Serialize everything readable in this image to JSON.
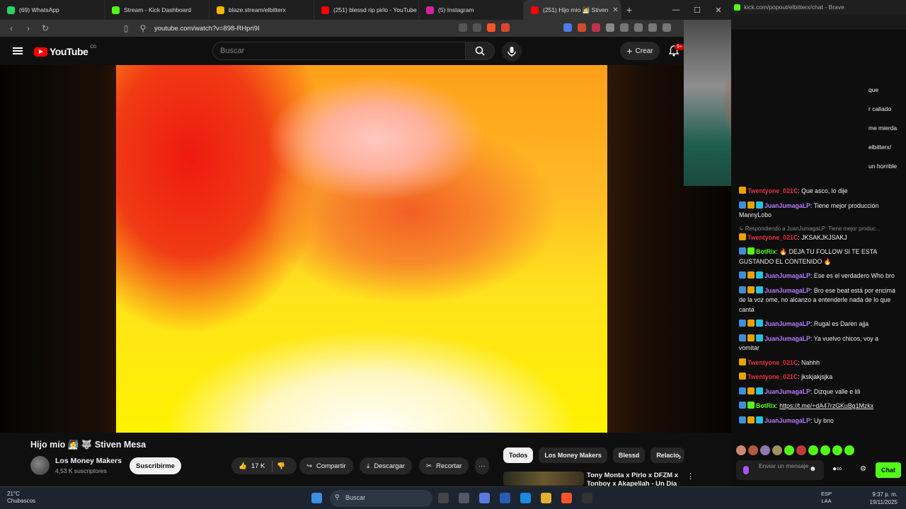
{
  "browser_tabs": [
    {
      "label": "(69) WhatsApp",
      "color": "#25d366"
    },
    {
      "label": "Stream - Kick Dashboard",
      "color": "#53fc18"
    },
    {
      "label": "blaze.stream/elbitterx",
      "color": "#f5b800"
    },
    {
      "label": "(251) blessd rip pirlo - YouTube",
      "color": "#ff0000"
    },
    {
      "label": "(5) Instagram",
      "color": "#d6249f"
    },
    {
      "label": "(251) Hijo mío 🧖 Stiven",
      "color": "#ff0000"
    }
  ],
  "url": "youtube.com/watch?v=898-RHpri9I",
  "youtube": {
    "logo": "YouTube",
    "country": "CO",
    "search_placeholder": "Buscar",
    "create_label": "Crear",
    "notif_badge": "9+",
    "video_title": "Hijo mío 🧖 🐺 Stiven Mesa",
    "channel_name": "Los Money Makers",
    "subscribers": "4,53 K suscriptores",
    "subscribe_label": "Suscribirme",
    "likes": "17 K",
    "share_label": "Compartir",
    "download_label": "Descargar",
    "clip_label": "Recortar",
    "more_label": "···",
    "chips": [
      "Todos",
      "Los Money Makers",
      "Blessd",
      "Relacio"
    ],
    "rec_title": "Tony Monta x Pirlo x DFZM x Tonboy x Akapellah - Un Día F"
  },
  "kick_popup": {
    "url": "kick.com/popout/elbitterx/chat - Brave",
    "side_fragments": [
      "que",
      "r callado",
      "me mierda",
      "elbitterx/",
      "un horrible"
    ]
  },
  "chat": [
    {
      "user": "Twentyone_021C",
      "user_class": "u-red",
      "text": ": Que asco, lo dije",
      "badges": [
        "#e7a400"
      ]
    },
    {
      "user": "JuanJumagaLP",
      "user_class": "u-purple",
      "text": ": Tiene mejor producción MannyLobo",
      "badges": [
        "#3f8fd8",
        "#e7a400",
        "#29c0e0"
      ]
    },
    {
      "reply": "↳ Respondiendo a JuanJumagaLP: Tiene mejor produc...",
      "user": "Twentyone_021C",
      "user_class": "u-red",
      "text": ": JKSAKJKJSAKJ",
      "badges": [
        "#e7a400"
      ]
    },
    {
      "user": "BotRix",
      "user_class": "u-green",
      "text": ": 🔥 DEJA TU FOLLOW SI TE ESTA GUSTANDO EL CONTENIDO 🔥",
      "badges": [
        "#3f8fd8",
        "#53fc18"
      ]
    },
    {
      "user": "JuanJumagaLP",
      "user_class": "u-purple",
      "text": ": Ese es el verdadero Who bro",
      "badges": [
        "#3f8fd8",
        "#e7a400",
        "#29c0e0"
      ]
    },
    {
      "user": "JuanJumagaLP",
      "user_class": "u-purple",
      "text": ": Bro ese beat está por encima de la voz ome, no alcanzo a entenderle nada de lo que canta",
      "badges": [
        "#3f8fd8",
        "#e7a400",
        "#29c0e0"
      ]
    },
    {
      "user": "JuanJumagaLP",
      "user_class": "u-purple",
      "text": ": Rugal es Daren ajja",
      "badges": [
        "#3f8fd8",
        "#e7a400",
        "#29c0e0"
      ]
    },
    {
      "user": "JuanJumagaLP",
      "user_class": "u-purple",
      "text": ": Ya vuelvo chicos, voy a vomitar",
      "badges": [
        "#3f8fd8",
        "#e7a400",
        "#29c0e0"
      ]
    },
    {
      "user": "Twentyone_021C",
      "user_class": "u-red",
      "text": ": Nahhh",
      "badges": [
        "#e7a400"
      ]
    },
    {
      "user": "Twentyone_021C",
      "user_class": "u-red",
      "text": ": jkskjakjsjka",
      "badges": [
        "#e7a400"
      ]
    },
    {
      "user": "JuanJumagaLP",
      "user_class": "u-purple",
      "text": ": Dizque valle e lili",
      "badges": [
        "#3f8fd8",
        "#e7a400",
        "#29c0e0"
      ]
    },
    {
      "user": "BotRix",
      "user_class": "u-green",
      "text": ": ",
      "link": "https://t.me/+dA47rzGKuBg1Mzkx",
      "badges": [
        "#3f8fd8",
        "#53fc18"
      ]
    },
    {
      "user": "JuanJumagaLP",
      "user_class": "u-purple",
      "text": ": Uy bno",
      "badges": [
        "#3f8fd8",
        "#e7a400",
        "#29c0e0"
      ]
    }
  ],
  "chat_input_placeholder": "Enviar un mensaje",
  "chat_button": "Chat",
  "taskbar": {
    "temp": "21°C",
    "weather": "Chubascos",
    "search": "Buscar",
    "lang1": "ESP",
    "lang2": "LAA",
    "time": "9:37 p. m.",
    "date": "19/11/2025"
  }
}
